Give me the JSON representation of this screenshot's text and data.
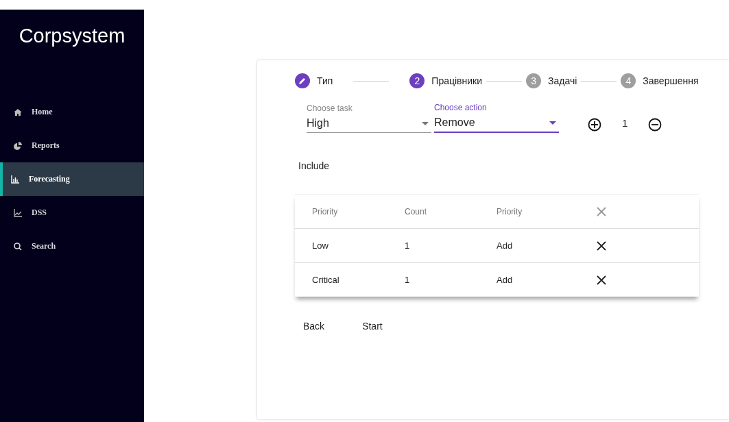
{
  "sidebar": {
    "logo": "Corpsystem",
    "items": [
      {
        "label": "Home",
        "kind": "home",
        "selected": false
      },
      {
        "label": "Reports",
        "kind": "pie",
        "selected": false
      },
      {
        "label": "Forecasting",
        "kind": "bars",
        "selected": true
      },
      {
        "label": "DSS",
        "kind": "line",
        "selected": false
      },
      {
        "label": "Search",
        "kind": "search",
        "selected": false
      }
    ]
  },
  "stepper": [
    {
      "label": "Тип",
      "completed": true,
      "active": false
    },
    {
      "number": "2",
      "label": "Працівники",
      "completed": false,
      "active": true
    },
    {
      "number": "3",
      "label": "Задачі",
      "completed": false,
      "active": false
    },
    {
      "number": "4",
      "label": "Завершення",
      "completed": false,
      "active": false
    }
  ],
  "form": {
    "fields": [
      {
        "label": "Choose task",
        "value": "High",
        "focused": false
      },
      {
        "label": "Choose action",
        "value": "Remove",
        "focused": true
      }
    ],
    "counter": "1"
  },
  "include_label": "Include",
  "table": {
    "columns": [
      "Priority",
      "Count",
      "Priority"
    ],
    "rows": [
      {
        "cells": [
          "Low",
          "1",
          "Add"
        ]
      },
      {
        "cells": [
          "Critical",
          "1",
          "Add"
        ]
      }
    ]
  },
  "buttons": [
    "Back",
    "Start"
  ]
}
